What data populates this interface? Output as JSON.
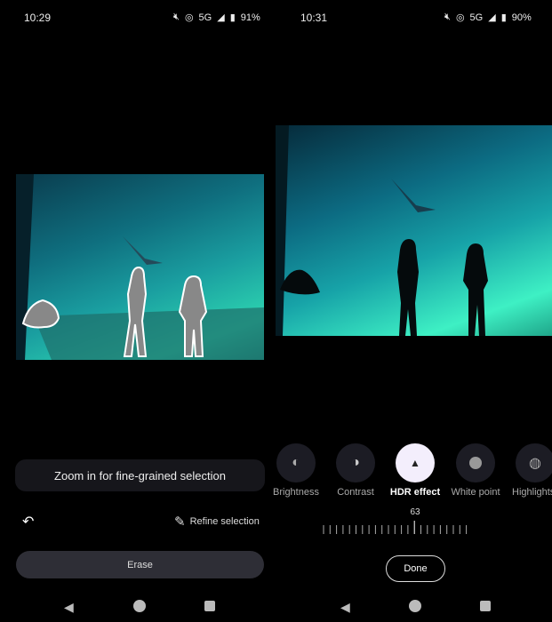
{
  "left": {
    "status": {
      "time": "10:29",
      "network": "5G",
      "battery": "91%"
    },
    "hint": "Zoom in for fine-grained selection",
    "undo_icon": "undo-icon",
    "refine_label": "Refine selection",
    "erase_label": "Erase"
  },
  "right": {
    "status": {
      "time": "10:31",
      "network": "5G",
      "battery": "90%"
    },
    "tools": [
      {
        "label": "Brightness",
        "icon": "brightness-icon"
      },
      {
        "label": "Contrast",
        "icon": "contrast-icon"
      },
      {
        "label": "HDR effect",
        "icon": "mountain-icon",
        "active": true
      },
      {
        "label": "White point",
        "icon": "circle-icon"
      },
      {
        "label": "Highlights",
        "icon": "highlights-icon"
      }
    ],
    "slider_value": "63",
    "done_label": "Done"
  },
  "colors": {
    "accent": "#f3eefc",
    "button": "#2e2e36"
  }
}
